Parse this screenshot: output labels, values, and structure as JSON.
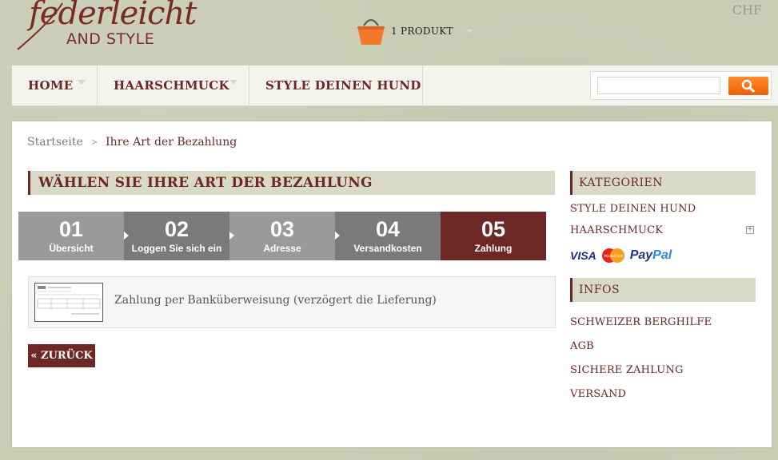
{
  "header": {
    "logo_script": "federleicht",
    "logo_sub": "AND STYLE",
    "cart_label": "1 PRODUKT",
    "currency": "CHF"
  },
  "nav": {
    "items": [
      {
        "label": "HOME"
      },
      {
        "label": "HAARSCHMUCK"
      },
      {
        "label": "STYLE DEINEN HUND"
      }
    ]
  },
  "search": {
    "value": "",
    "placeholder": ""
  },
  "breadcrumb": {
    "home": "Startseite",
    "separator": ">",
    "current": "Ihre Art der Bezahlung"
  },
  "main": {
    "heading": "WÄHLEN SIE IHRE ART DER BEZAHLUNG",
    "steps": [
      {
        "num": "01",
        "label": "Übersicht",
        "color": "#9a9a9a"
      },
      {
        "num": "02",
        "label": "Loggen Sie sich ein",
        "color": "#7a7a7a"
      },
      {
        "num": "03",
        "label": "Adresse",
        "color": "#9a9a9a"
      },
      {
        "num": "04",
        "label": "Versandkosten",
        "color": "#7a7a7a"
      },
      {
        "num": "05",
        "label": "Zahlung",
        "color": "#6d2724"
      }
    ],
    "payment_option": "Zahlung per Banküberweisung (verzögert die Lieferung)",
    "back_button": "« ZURÜCK"
  },
  "sidebar": {
    "categories_title": "KATEGORIEN",
    "categories": [
      "STYLE DEINEN HUND",
      "HAARSCHMUCK"
    ],
    "payment_logos": {
      "visa": "VISA",
      "mastercard": "MasterCard",
      "paypal_pay": "Pay",
      "paypal_pal": "Pal"
    },
    "infos_title": "INFOS",
    "infos": [
      "SCHWEIZER BERGHILFE",
      "AGB",
      "SICHERE ZAHLUNG",
      "VERSAND"
    ]
  },
  "colors": {
    "brand": "#6d2724",
    "accent_orange": "#f26b0f",
    "band": "#d9dac6"
  }
}
